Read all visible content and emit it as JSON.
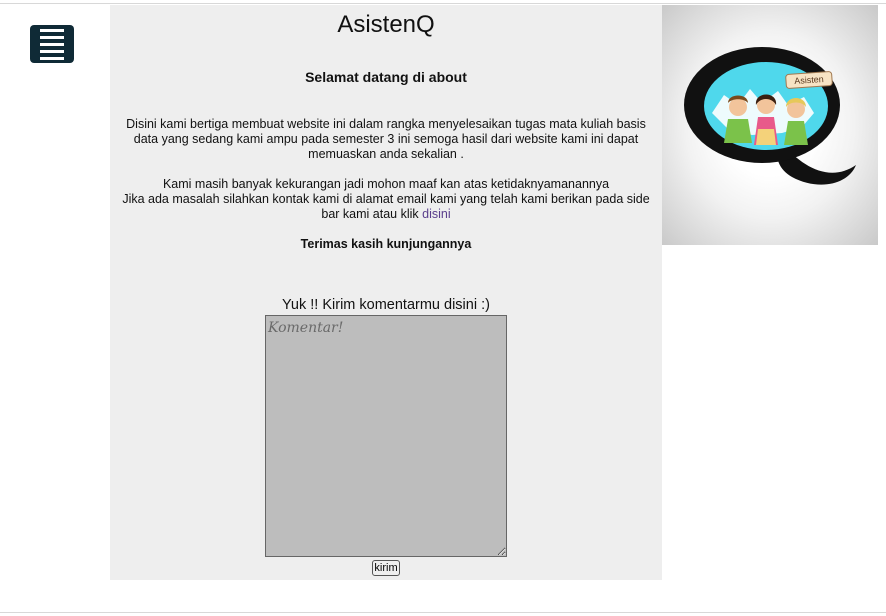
{
  "menu": {
    "icon": "hamburger-menu-icon"
  },
  "page": {
    "title": "AsistenQ",
    "welcome": "Selamat datang di about",
    "paragraph1": "Disini kami bertiga membuat website ini dalam rangka menyelesaikan tugas mata kuliah basis data yang sedang kami ampu pada semester 3 ini semoga hasil dari website kami ini dapat memuaskan anda sekalian .",
    "paragraph2_line1": "Kami masih banyak kekurangan jadi mohon maaf kan atas ketidaknyamanannya",
    "paragraph2_line2": "Jika ada masalah silahkan kontak kami di alamat email kami yang telah kami berikan pada side bar kami atau klik",
    "paragraph2_link": "disini",
    "thanks": "Terimas kasih kunjungannya"
  },
  "comment": {
    "heading": "Yuk !! Kirim komentarmu disini :)",
    "placeholder": "Komentar!",
    "submit_label": "kirim"
  },
  "logo": {
    "badge_text": "Asisten"
  },
  "colors": {
    "menu_bg": "#0f2a36",
    "content_bg": "#eeeeee",
    "textarea_bg": "#bdbdbd",
    "link": "#5a3e8c",
    "logo_accent": "#4fd8ec"
  }
}
